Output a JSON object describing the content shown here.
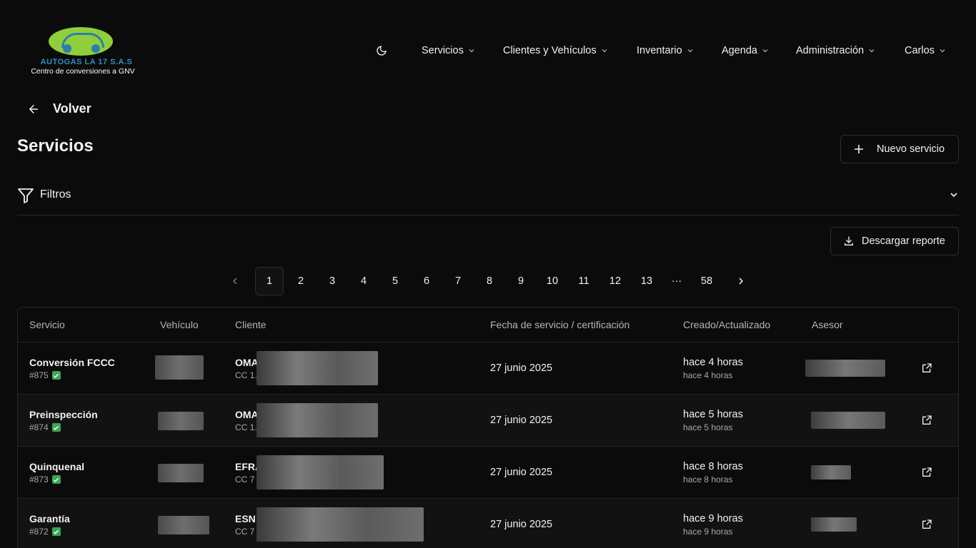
{
  "logo": {
    "brand": "AUTOGAS LA 17 S.A.S",
    "tagline": "Centro de conversiones a GNV"
  },
  "header": {
    "theme_icon": "moon-icon",
    "nav": [
      {
        "label": "Servicios"
      },
      {
        "label": "Clientes y Vehículos"
      },
      {
        "label": "Inventario"
      },
      {
        "label": "Agenda"
      },
      {
        "label": "Administración"
      },
      {
        "label": "Carlos"
      }
    ]
  },
  "back": {
    "label": "Volver"
  },
  "page": {
    "title": "Servicios"
  },
  "actions": {
    "new_service": "Nuevo servicio",
    "download_report": "Descargar reporte"
  },
  "filters": {
    "label": "Filtros"
  },
  "pagination": {
    "current": "1",
    "pages": [
      "1",
      "2",
      "3",
      "4",
      "5",
      "6",
      "7",
      "8",
      "9",
      "10",
      "11",
      "12",
      "13"
    ],
    "ellipsis": "···",
    "last": "58"
  },
  "table": {
    "columns": [
      "Servicio",
      "Vehículo",
      "Cliente",
      "Fecha de servicio / certificación",
      "Creado/Actualizado",
      "Asesor"
    ],
    "rows": [
      {
        "service": "Conversión FCCC",
        "number": "#875",
        "client_name": "OMA",
        "client_doc": "CC 1.",
        "date": "27 junio 2025",
        "updated": "hace 4 horas",
        "created": "hace 4 horas"
      },
      {
        "service": "Preinspección",
        "number": "#874",
        "client_name": "OMA",
        "client_doc": "CC 1.",
        "date": "27 junio 2025",
        "updated": "hace 5 horas",
        "created": "hace 5 horas"
      },
      {
        "service": "Quinquenal",
        "number": "#873",
        "client_name": "EFRA",
        "client_doc": "CC 7",
        "date": "27 junio 2025",
        "updated": "hace 8 horas",
        "created": "hace 8 horas"
      },
      {
        "service": "Garantía",
        "number": "#872",
        "client_name": "ESN",
        "client_doc": "CC 7",
        "date": "27 junio 2025",
        "updated": "hace 9 horas",
        "created": "hace 9 horas"
      }
    ]
  },
  "colors": {
    "background": "#0b0b0b",
    "border": "#262626",
    "check": "#3aa655",
    "logo_green": "#8fcf3a",
    "logo_blue": "#2e8fc8"
  }
}
